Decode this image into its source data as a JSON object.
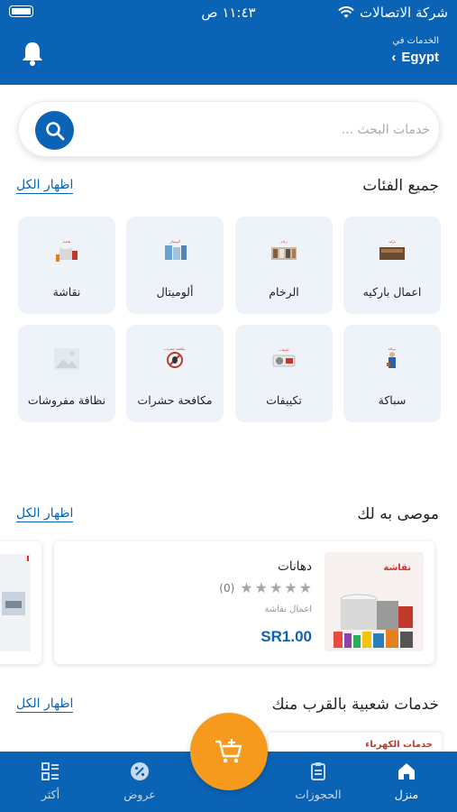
{
  "status_bar": {
    "carrier": "شركة الاتصالات",
    "time": "١١:٤٣ ص"
  },
  "header": {
    "location_caption": "الخدمات في",
    "location_value": "Egypt",
    "bell_icon": "bell-icon"
  },
  "search": {
    "placeholder": "خدمات البحث ...",
    "icon": "search-icon"
  },
  "categories_section": {
    "title": "جميع الفئات",
    "show_all": "اظهار الكل",
    "items": [
      {
        "label": "اعمال باركيه",
        "tag": "باركيه"
      },
      {
        "label": "الرخام",
        "tag": "رخام"
      },
      {
        "label": "ألوميتال",
        "tag": "ألوميتال"
      },
      {
        "label": "نقاشة",
        "tag": "نقاشة"
      },
      {
        "label": "سباكة",
        "tag": "سباكة"
      },
      {
        "label": "تكييفات",
        "tag": "تكييفات"
      },
      {
        "label": "مكافحة حشرات",
        "tag": "مكافحة حشرات"
      },
      {
        "label": "نظافة مفروشات",
        "tag": ""
      }
    ]
  },
  "recommended_section": {
    "title": "موصى به لك",
    "show_all": "اظهار الكل",
    "product": {
      "image_tag": "نقاشة",
      "name": "دهانات",
      "rating_stars": 0,
      "rating_count": "(0)",
      "category": "اعمال نقاشة",
      "price": "SR1.00"
    }
  },
  "nearby_section": {
    "title": "خدمات شعبية بالقرب منك",
    "show_all": "اظهار الكل",
    "peek_text": "خدمات الكهرباء"
  },
  "bottom_nav": {
    "items": [
      {
        "label": "منزل",
        "icon": "home-icon"
      },
      {
        "label": "الحجوزات",
        "icon": "bookings-icon"
      },
      {
        "label": "عروض",
        "icon": "offers-icon"
      },
      {
        "label": "أكثر",
        "icon": "more-icon"
      }
    ],
    "fab_icon": "cart-add-icon"
  },
  "colors": {
    "primary": "#0a63b5",
    "accent": "#f59a1c",
    "tile_bg": "#eef3fa"
  }
}
